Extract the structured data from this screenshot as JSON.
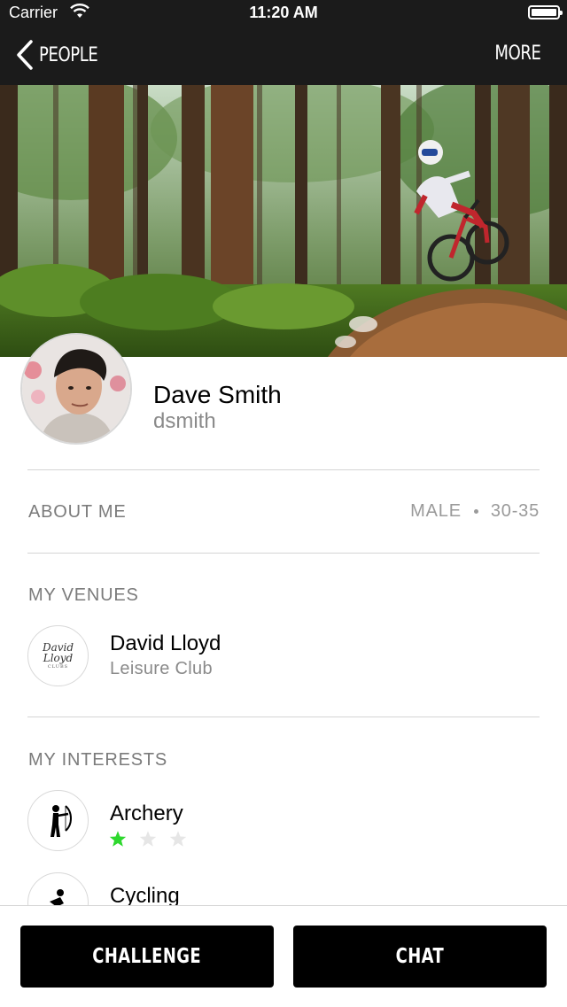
{
  "status_bar": {
    "carrier": "Carrier",
    "time": "11:20 AM"
  },
  "nav": {
    "back_label": "PEOPLE",
    "more_label": "MORE"
  },
  "profile": {
    "name": "Dave Smith",
    "username": "dsmith"
  },
  "about": {
    "title": "ABOUT ME",
    "gender": "MALE",
    "age_range": "30-35"
  },
  "venues": {
    "title": "MY VENUES",
    "items": [
      {
        "name": "David Lloyd",
        "type": "Leisure Club",
        "logo_text": "David Lloyd",
        "logo_sub": "CLUBS"
      }
    ]
  },
  "interests": {
    "title": "MY INTERESTS",
    "items": [
      {
        "name": "Archery",
        "icon": "archery-icon",
        "rating": 1,
        "max_rating": 3
      },
      {
        "name": "Cycling",
        "icon": "cycling-icon"
      }
    ]
  },
  "actions": {
    "challenge_label": "CHALLENGE",
    "chat_label": "CHAT"
  },
  "colors": {
    "nav_bg": "#1b1b1b",
    "star_active": "#2ed82e",
    "star_inactive": "#e6e6e6",
    "button_bg": "#000000"
  }
}
